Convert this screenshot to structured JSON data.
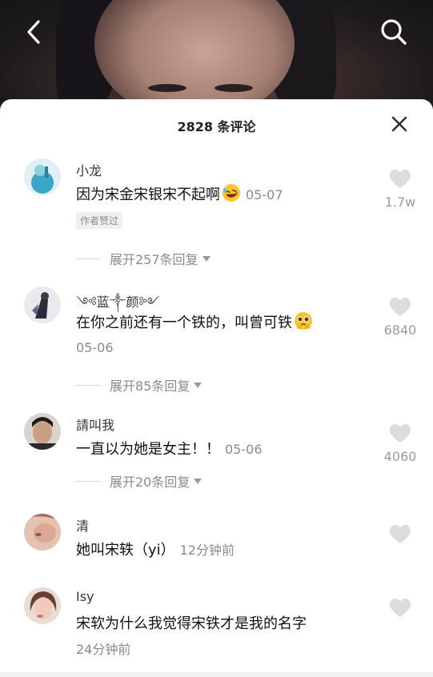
{
  "header": {
    "title": "2828 条评论"
  },
  "comments": [
    {
      "username": "小龙",
      "text": "因为宋金宋银宋不起啊",
      "emoji": "rofl-emoji",
      "time": "05-07",
      "badge": "作者赞过",
      "likes": "1.7w",
      "replies": "展开257条回复"
    },
    {
      "username": "༺蓝༒颜༻",
      "text": "在你之前还有一个铁的，叫曾可铁",
      "emoji": "pleading-emoji",
      "time": "05-06",
      "likes": "6840",
      "replies": "展开85条回复"
    },
    {
      "username": "請叫我",
      "text": "一直以为她是女主！！",
      "time": "05-06",
      "likes": "4060",
      "replies": "展开20条回复"
    },
    {
      "username": "清",
      "text": "她叫宋轶（yi）",
      "time": "12分钟前",
      "likes": ""
    },
    {
      "username": "Isy",
      "text": "宋软为什么我觉得宋铁才是我的名字",
      "time": "24分钟前",
      "likes": ""
    }
  ]
}
